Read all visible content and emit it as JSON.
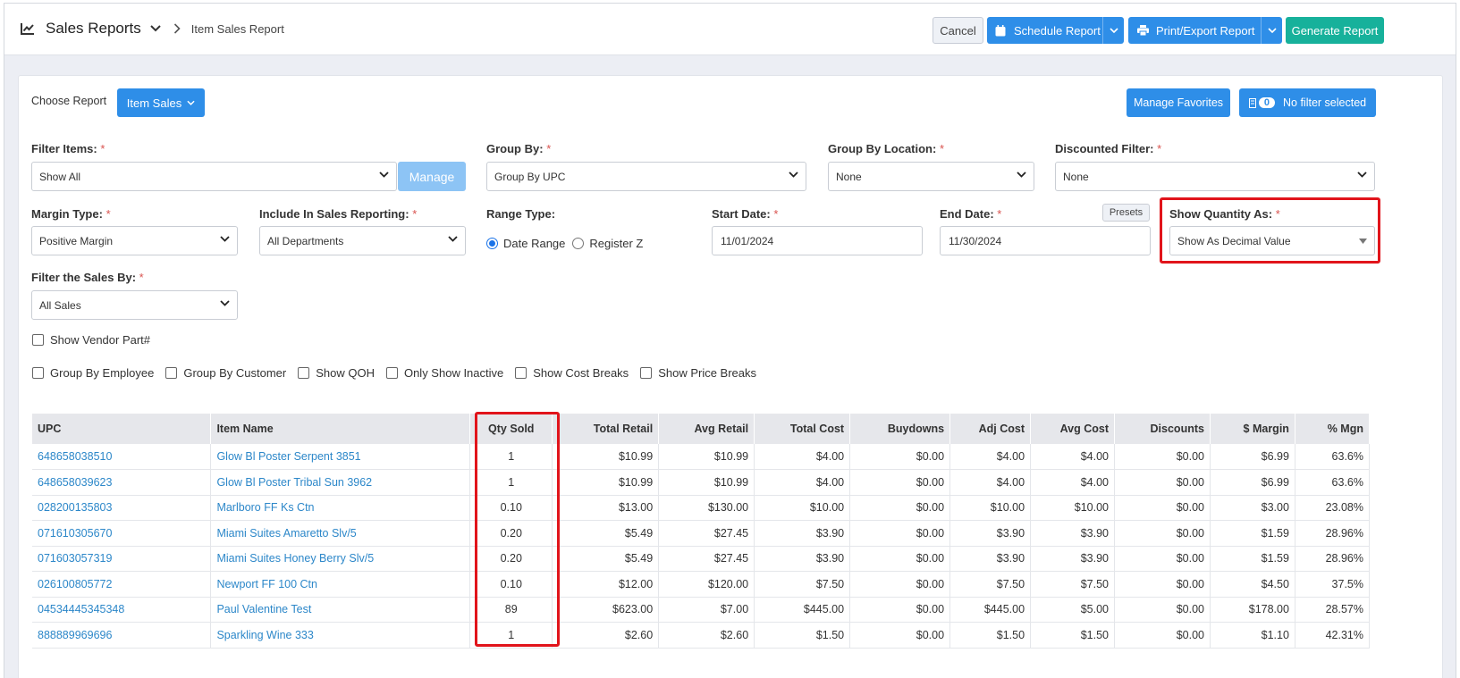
{
  "header": {
    "title": "Sales Reports",
    "breadcrumb": "Item Sales Report",
    "cancel_label": "Cancel",
    "schedule_label": "Schedule Report",
    "print_label": "Print/Export Report",
    "generate_label": "Generate Report"
  },
  "colors": {
    "accent_blue": "#2e8ee8",
    "teal": "#17b19b",
    "highlight_red": "#e1141b",
    "link": "#2c87c9"
  },
  "choose_report": {
    "label": "Choose Report",
    "value": "Item Sales"
  },
  "favorites_label": "Manage Favorites",
  "filter_badge": {
    "count": "0",
    "label": "No filter selected"
  },
  "filters": {
    "filter_items": {
      "label": "Filter Items:",
      "value": "Show All",
      "manage": "Manage"
    },
    "group_by": {
      "label": "Group By:",
      "value": "Group By UPC"
    },
    "group_by_location": {
      "label": "Group By Location:",
      "value": "None"
    },
    "discounted": {
      "label": "Discounted Filter:",
      "value": "None"
    },
    "margin_type": {
      "label": "Margin Type:",
      "value": "Positive Margin"
    },
    "include_in_sales": {
      "label": "Include In Sales Reporting:",
      "value": "All Departments"
    },
    "range_type": {
      "label": "Range Type:",
      "opt1": "Date Range",
      "opt2": "Register Z"
    },
    "start_date": {
      "label": "Start Date:",
      "value": "11/01/2024"
    },
    "end_date": {
      "label": "End Date:",
      "value": "11/30/2024",
      "presets": "Presets"
    },
    "show_quantity": {
      "label": "Show Quantity As:",
      "value": "Show As Decimal Value"
    },
    "filter_sales_by": {
      "label": "Filter the Sales By:",
      "value": "All Sales"
    },
    "req": "*"
  },
  "checkboxes": {
    "vendor_part": "Show Vendor Part#",
    "group_employee": "Group By Employee",
    "group_customer": "Group By Customer",
    "show_qoh": "Show QOH",
    "only_inactive": "Only Show Inactive",
    "cost_breaks": "Show Cost Breaks",
    "price_breaks": "Show Price Breaks"
  },
  "table": {
    "headers": [
      "UPC",
      "Item Name",
      "Qty Sold",
      "Total Retail",
      "Avg Retail",
      "Total Cost",
      "Buydowns",
      "Adj Cost",
      "Avg Cost",
      "Discounts",
      "$ Margin",
      "% Mgn"
    ],
    "rows": [
      [
        "648658038510",
        "Glow Bl Poster Serpent 3851",
        "1",
        "$10.99",
        "$10.99",
        "$4.00",
        "$0.00",
        "$4.00",
        "$4.00",
        "$0.00",
        "$6.99",
        "63.6%"
      ],
      [
        "648658039623",
        "Glow Bl Poster Tribal Sun 3962",
        "1",
        "$10.99",
        "$10.99",
        "$4.00",
        "$0.00",
        "$4.00",
        "$4.00",
        "$0.00",
        "$6.99",
        "63.6%"
      ],
      [
        "028200135803",
        "Marlboro FF Ks Ctn",
        "0.10",
        "$13.00",
        "$130.00",
        "$10.00",
        "$0.00",
        "$10.00",
        "$10.00",
        "$0.00",
        "$3.00",
        "23.08%"
      ],
      [
        "071610305670",
        "Miami Suites Amaretto Slv/5",
        "0.20",
        "$5.49",
        "$27.45",
        "$3.90",
        "$0.00",
        "$3.90",
        "$3.90",
        "$0.00",
        "$1.59",
        "28.96%"
      ],
      [
        "071603057319",
        "Miami Suites Honey Berry Slv/5",
        "0.20",
        "$5.49",
        "$27.45",
        "$3.90",
        "$0.00",
        "$3.90",
        "$3.90",
        "$0.00",
        "$1.59",
        "28.96%"
      ],
      [
        "026100805772",
        "Newport FF 100 Ctn",
        "0.10",
        "$12.00",
        "$120.00",
        "$7.50",
        "$0.00",
        "$7.50",
        "$7.50",
        "$0.00",
        "$4.50",
        "37.5%"
      ],
      [
        "04534445345348",
        "Paul Valentine Test",
        "89",
        "$623.00",
        "$7.00",
        "$445.00",
        "$0.00",
        "$445.00",
        "$5.00",
        "$0.00",
        "$178.00",
        "28.57%"
      ],
      [
        "888889969696",
        "Sparkling Wine 333",
        "1",
        "$2.60",
        "$2.60",
        "$1.50",
        "$0.00",
        "$1.50",
        "$1.50",
        "$0.00",
        "$1.10",
        "42.31%"
      ]
    ]
  }
}
